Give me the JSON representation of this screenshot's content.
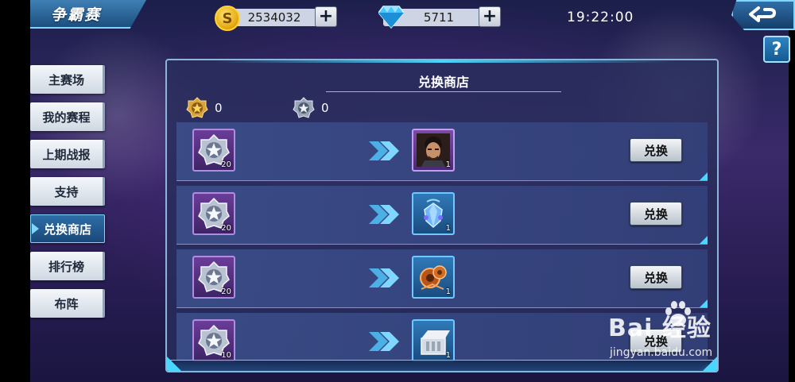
{
  "header": {
    "title": "争霸赛",
    "gold": "2534032",
    "diamonds": "5711",
    "time": "19:22:00",
    "help_label": "?"
  },
  "side_menu": [
    {
      "label": "主赛场",
      "active": false
    },
    {
      "label": "我的赛程",
      "active": false
    },
    {
      "label": "上期战报",
      "active": false
    },
    {
      "label": "支持",
      "active": false
    },
    {
      "label": "兑换商店",
      "active": true
    },
    {
      "label": "排行榜",
      "active": false
    },
    {
      "label": "布阵",
      "active": false
    }
  ],
  "shop": {
    "title": "兑换商店",
    "gold_medal_count": "0",
    "silver_medal_count": "0",
    "rows": [
      {
        "cost_icon": "silver-medal-icon",
        "cost_qty": "20",
        "reward_icon": "hero-portrait-icon",
        "reward_qty": "1",
        "reward_frame": "purple",
        "button": "兑换"
      },
      {
        "cost_icon": "silver-medal-icon",
        "cost_qty": "20",
        "reward_icon": "crystal-gem-icon",
        "reward_qty": "1",
        "reward_frame": "blue",
        "button": "兑换"
      },
      {
        "cost_icon": "silver-medal-icon",
        "cost_qty": "20",
        "reward_icon": "bronze-gear-icon",
        "reward_qty": "1",
        "reward_frame": "blue",
        "button": "兑换"
      },
      {
        "cost_icon": "silver-medal-icon",
        "cost_qty": "10",
        "reward_icon": "material-box-icon",
        "reward_qty": "1",
        "reward_frame": "blue",
        "button": "兑换"
      }
    ]
  },
  "watermark": {
    "brand": "Bai 经验",
    "site": "jingyan.baidu.com"
  },
  "colors": {
    "accent": "#4ad7ff",
    "panel": "#282e5c",
    "purple_frame": "#7a4ba8",
    "blue_frame": "#2f79b8"
  }
}
